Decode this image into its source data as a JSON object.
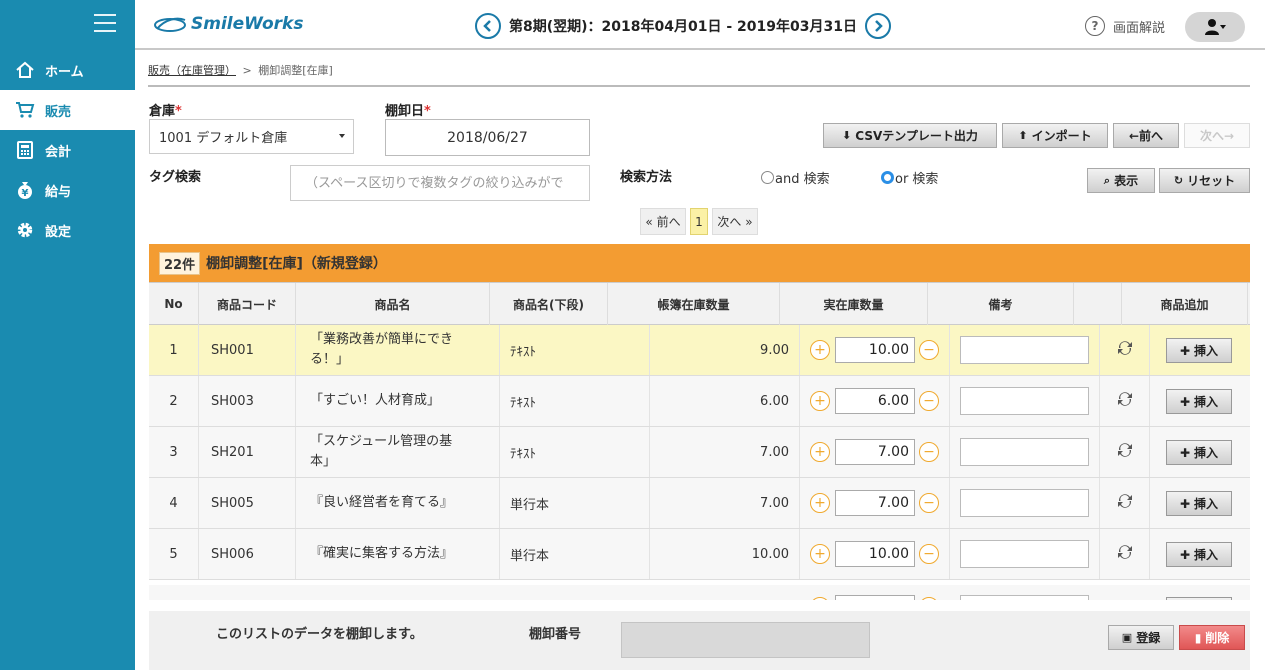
{
  "sidebar": {
    "items": [
      {
        "label": "ホーム",
        "icon": "home-icon"
      },
      {
        "label": "販売",
        "icon": "cart-icon",
        "active": true
      },
      {
        "label": "会計",
        "icon": "calculator-icon"
      },
      {
        "label": "給与",
        "icon": "money-bag-icon"
      },
      {
        "label": "設定",
        "icon": "gear-icon"
      }
    ]
  },
  "header": {
    "logo": "SmileWorks",
    "period": "第8期(翌期)：2018年04月01日 - 2019年03月31日",
    "help_label": "画面解説"
  },
  "breadcrumb": {
    "parent": "販売（在庫管理）",
    "separator": ">",
    "current": "棚卸調整[在庫]"
  },
  "form": {
    "warehouse_label": "倉庫",
    "warehouse_value": "1001 デフォルト倉庫",
    "date_label": "棚卸日",
    "date_value": "2018/06/27",
    "tag_label": "タグ検索",
    "tag_placeholder": "（スペース区切りで複数タグの絞り込みがで",
    "search_method_label": "検索方法",
    "and_label": "and 検索",
    "or_label": "or 検索",
    "required_mark": "*"
  },
  "toolbar": {
    "csv_label": "CSVテンプレート出力",
    "import_label": "インポート",
    "prev_label": "←前へ",
    "next_label": "次へ→",
    "show_label": "表示",
    "reset_label": "リセット"
  },
  "pagination": {
    "prev": "« 前へ",
    "current": "1",
    "next": "次へ »"
  },
  "section": {
    "count": "22件",
    "title": "棚卸調整[在庫]（新規登録）"
  },
  "table": {
    "headers": [
      "No",
      "商品コード",
      "商品名",
      "商品名(下段)",
      "帳簿在庫数量",
      "実在庫数量",
      "備考",
      "",
      "商品追加"
    ],
    "insert_label": "挿入",
    "rows": [
      {
        "no": "1",
        "code": "SH001",
        "name": "「業務改善が簡単にできる！」",
        "sub": "ﾃｷｽﾄ",
        "book": "9.00",
        "actual": "10.00"
      },
      {
        "no": "2",
        "code": "SH003",
        "name": "「すごい！人材育成」",
        "sub": "ﾃｷｽﾄ",
        "book": "6.00",
        "actual": "6.00"
      },
      {
        "no": "3",
        "code": "SH201",
        "name": "「スケジュール管理の基本」",
        "sub": "ﾃｷｽﾄ",
        "book": "7.00",
        "actual": "7.00"
      },
      {
        "no": "4",
        "code": "SH005",
        "name": "『良い経営者を育てる』",
        "sub": "単行本",
        "book": "7.00",
        "actual": "7.00"
      },
      {
        "no": "5",
        "code": "SH006",
        "name": "『確実に集客する方法』",
        "sub": "単行本",
        "book": "10.00",
        "actual": "10.00"
      }
    ]
  },
  "footer": {
    "message": "このリストのデータを棚卸します。",
    "inventory_no_label": "棚卸番号",
    "register_label": "登録",
    "delete_label": "削除"
  },
  "colors": {
    "sidebar": "#1a8bb0",
    "section_header": "#f39c32",
    "highlight_row": "#fbf7c4",
    "accent": "#f0a92e"
  }
}
